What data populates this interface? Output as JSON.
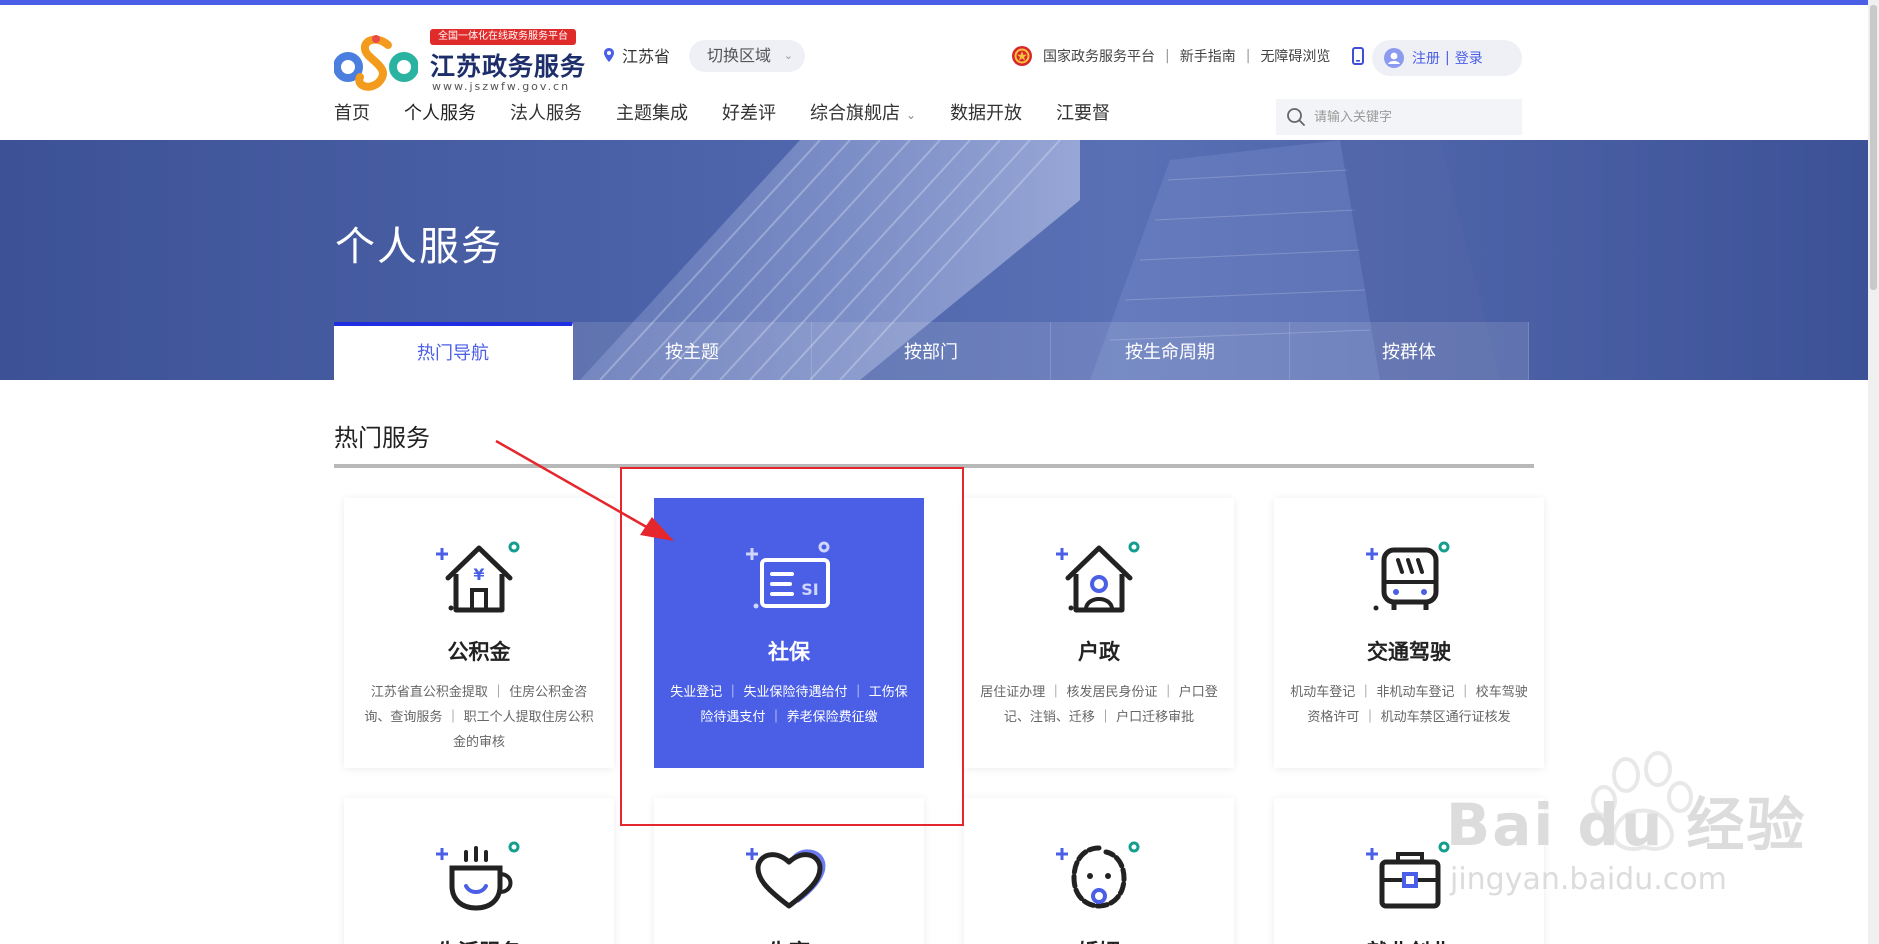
{
  "logo": {
    "slogan": "全国一体化在线政务服务平台",
    "name": "江苏政务服务",
    "url": "www.jszwfw.gov.cn"
  },
  "region": {
    "current": "江苏省",
    "switch_label": "切换区域"
  },
  "util_links": {
    "national": "国家政务服务平台",
    "guide": "新手指南",
    "accessible": "无障碍浏览",
    "separator": "|"
  },
  "login": {
    "register": "注册",
    "separator": "|",
    "login": "登录"
  },
  "nav": {
    "items": [
      {
        "label": "首页"
      },
      {
        "label": "个人服务"
      },
      {
        "label": "法人服务"
      },
      {
        "label": "主题集成"
      },
      {
        "label": "好差评"
      },
      {
        "label": "综合旗舰店"
      },
      {
        "label": "数据开放"
      },
      {
        "label": "江要督"
      }
    ],
    "active_index": 1
  },
  "search": {
    "placeholder": "请输入关键字"
  },
  "banner": {
    "title": "个人服务"
  },
  "tabs": [
    {
      "label": "热门导航"
    },
    {
      "label": "按主题"
    },
    {
      "label": "按部门"
    },
    {
      "label": "按生命周期"
    },
    {
      "label": "按群体"
    }
  ],
  "hot_services": {
    "title": "热门服务",
    "cards": [
      {
        "title": "公积金",
        "desc": "江苏省直公积金提取 ｜ 住房公积金咨询、查询服务 ｜ 职工个人提取住房公积金的审核"
      },
      {
        "title": "社保",
        "desc": "失业登记 ｜ 失业保险待遇给付 ｜ 工伤保险待遇支付 ｜ 养老保险费征缴"
      },
      {
        "title": "户政",
        "desc": "居住证办理 ｜ 核发居民身份证 ｜ 户口登记、注销、迁移 ｜ 户口迁移审批"
      },
      {
        "title": "交通驾驶",
        "desc": "机动车登记 ｜ 非机动车登记 ｜ 校车驾驶资格许可 ｜ 机动车禁区通行证核发"
      }
    ],
    "bottom_cards": [
      {
        "title": "生活服务"
      },
      {
        "title": "生育"
      },
      {
        "title": "婚姻"
      },
      {
        "title": "就业创业"
      }
    ]
  },
  "watermark": {
    "brand": "Bai du 经验",
    "url": "jingyan.baidu.com"
  },
  "colors": {
    "accent": "#4a5ee6",
    "highlight": "#e5262c",
    "teal": "#159e8f"
  }
}
